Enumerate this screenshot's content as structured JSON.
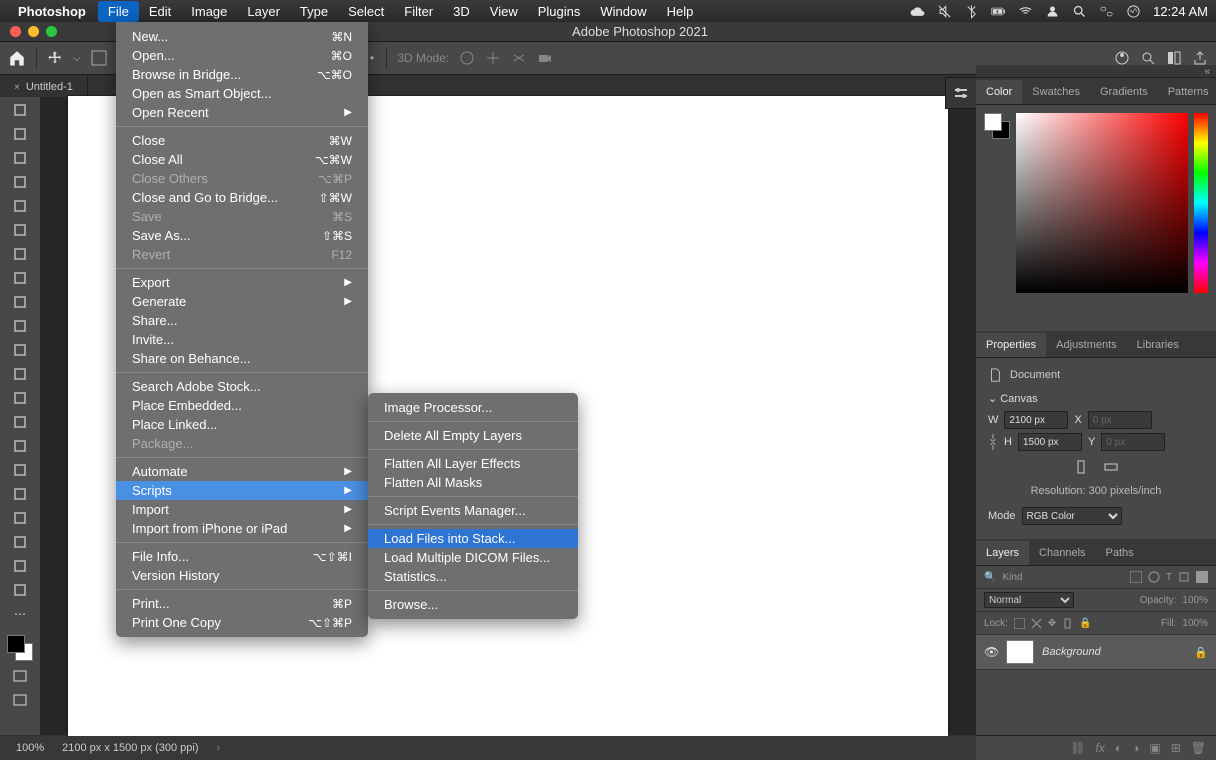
{
  "mac": {
    "app": "Photoshop",
    "menus": [
      "File",
      "Edit",
      "Image",
      "Layer",
      "Type",
      "Select",
      "Filter",
      "3D",
      "View",
      "Plugins",
      "Window",
      "Help"
    ],
    "open_menu_index": 0,
    "clock": "12:24 AM"
  },
  "window": {
    "title": "Adobe Photoshop 2021"
  },
  "option_bar": {
    "threeD": "3D Mode:"
  },
  "doc_tab": {
    "label": "Untitled-1"
  },
  "status": {
    "zoom": "100%",
    "info": "2100 px x 1500 px (300 ppi)"
  },
  "panels": {
    "color_tabs": [
      "Color",
      "Swatches",
      "Gradients",
      "Patterns"
    ],
    "props_tabs": [
      "Properties",
      "Adjustments",
      "Libraries"
    ],
    "layers_tabs": [
      "Layers",
      "Channels",
      "Paths"
    ]
  },
  "properties": {
    "title": "Document",
    "section": "Canvas",
    "W": "W",
    "Wv": "2100 px",
    "X": "X",
    "Xv": "0 px",
    "H": "H",
    "Hv": "1500 px",
    "Y": "Y",
    "Yv": "0 px",
    "resolution": "Resolution: 300 pixels/inch",
    "mode_label": "Mode",
    "mode": "RGB Color"
  },
  "layers": {
    "filter_label": "Kind",
    "blend": "Normal",
    "opacity_label": "Opacity:",
    "opacity": "100%",
    "lock_label": "Lock:",
    "fill_label": "Fill:",
    "fill": "100%",
    "bg": "Background"
  },
  "file_menu": [
    {
      "t": "item",
      "label": "New...",
      "sc": "⌘N"
    },
    {
      "t": "item",
      "label": "Open...",
      "sc": "⌘O"
    },
    {
      "t": "item",
      "label": "Browse in Bridge...",
      "sc": "⌥⌘O"
    },
    {
      "t": "item",
      "label": "Open as Smart Object..."
    },
    {
      "t": "item",
      "label": "Open Recent",
      "sub": true
    },
    {
      "t": "sep"
    },
    {
      "t": "item",
      "label": "Close",
      "sc": "⌘W"
    },
    {
      "t": "item",
      "label": "Close All",
      "sc": "⌥⌘W"
    },
    {
      "t": "item",
      "label": "Close Others",
      "sc": "⌥⌘P",
      "dis": true
    },
    {
      "t": "item",
      "label": "Close and Go to Bridge...",
      "sc": "⇧⌘W"
    },
    {
      "t": "item",
      "label": "Save",
      "sc": "⌘S",
      "dis": true
    },
    {
      "t": "item",
      "label": "Save As...",
      "sc": "⇧⌘S"
    },
    {
      "t": "item",
      "label": "Revert",
      "sc": "F12",
      "dis": true
    },
    {
      "t": "sep"
    },
    {
      "t": "item",
      "label": "Export",
      "sub": true
    },
    {
      "t": "item",
      "label": "Generate",
      "sub": true
    },
    {
      "t": "item",
      "label": "Share..."
    },
    {
      "t": "item",
      "label": "Invite..."
    },
    {
      "t": "item",
      "label": "Share on Behance..."
    },
    {
      "t": "sep"
    },
    {
      "t": "item",
      "label": "Search Adobe Stock..."
    },
    {
      "t": "item",
      "label": "Place Embedded..."
    },
    {
      "t": "item",
      "label": "Place Linked..."
    },
    {
      "t": "item",
      "label": "Package...",
      "dis": true
    },
    {
      "t": "sep"
    },
    {
      "t": "item",
      "label": "Automate",
      "sub": true
    },
    {
      "t": "item",
      "label": "Scripts",
      "sub": true,
      "hl": true
    },
    {
      "t": "item",
      "label": "Import",
      "sub": true
    },
    {
      "t": "item",
      "label": "Import from iPhone or iPad",
      "sub": true
    },
    {
      "t": "sep"
    },
    {
      "t": "item",
      "label": "File Info...",
      "sc": "⌥⇧⌘I"
    },
    {
      "t": "item",
      "label": "Version History"
    },
    {
      "t": "sep"
    },
    {
      "t": "item",
      "label": "Print...",
      "sc": "⌘P"
    },
    {
      "t": "item",
      "label": "Print One Copy",
      "sc": "⌥⇧⌘P"
    }
  ],
  "scripts_menu": [
    {
      "t": "item",
      "label": "Image Processor..."
    },
    {
      "t": "sep"
    },
    {
      "t": "item",
      "label": "Delete All Empty Layers"
    },
    {
      "t": "sep"
    },
    {
      "t": "item",
      "label": "Flatten All Layer Effects"
    },
    {
      "t": "item",
      "label": "Flatten All Masks"
    },
    {
      "t": "sep"
    },
    {
      "t": "item",
      "label": "Script Events Manager..."
    },
    {
      "t": "sep"
    },
    {
      "t": "item",
      "label": "Load Files into Stack...",
      "hl": true
    },
    {
      "t": "item",
      "label": "Load Multiple DICOM Files..."
    },
    {
      "t": "item",
      "label": "Statistics..."
    },
    {
      "t": "sep"
    },
    {
      "t": "item",
      "label": "Browse..."
    }
  ]
}
